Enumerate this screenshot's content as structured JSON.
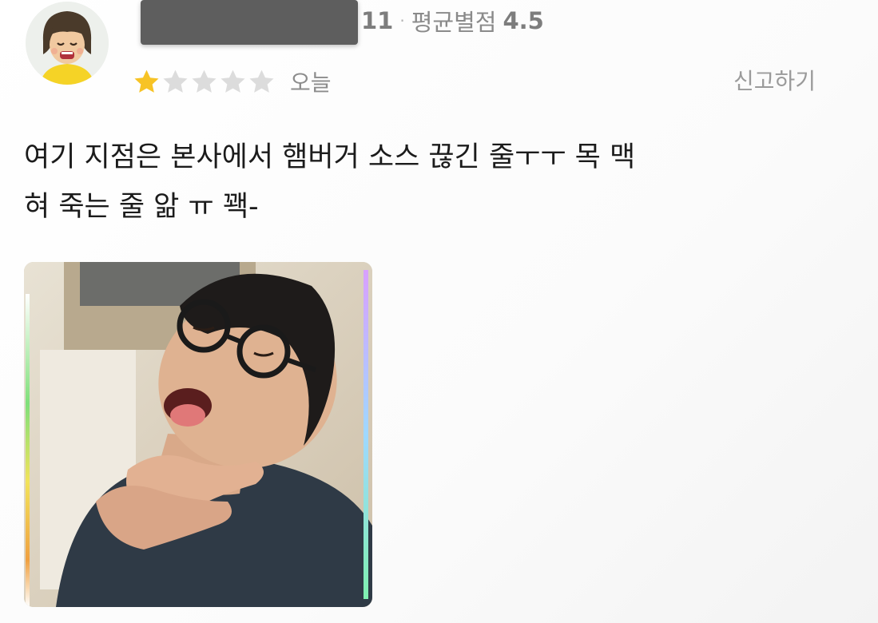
{
  "review": {
    "reviewer_stats": {
      "review_count": "11",
      "separator": "·",
      "average_label": "평균별점",
      "average_value": "4.5"
    },
    "rating": {
      "value": 1,
      "max": 5,
      "filled_color": "#f7c325",
      "empty_color": "#dcdcdc"
    },
    "date": "오늘",
    "report_label": "신고하기",
    "body_lines": [
      "여기 지점은 본사에서 햄버거 소스 끊긴 줄ㅜㅜ 목 맥",
      "혀 죽는 줄 앎 ㅠ 꽥-"
    ],
    "icons": {
      "avatar": "cartoon-avatar-icon",
      "star": "star-icon"
    }
  }
}
